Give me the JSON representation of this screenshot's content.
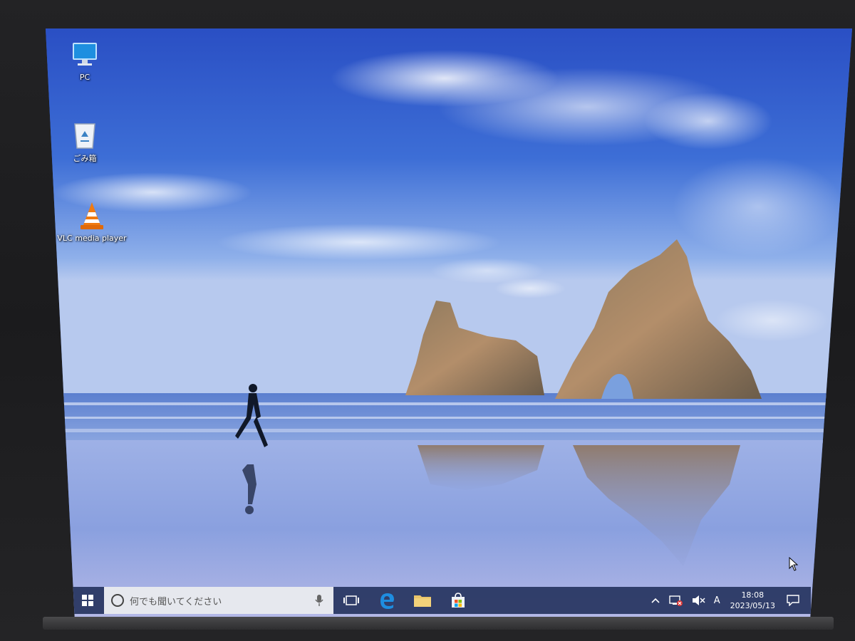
{
  "desktop": {
    "icons": [
      {
        "id": "pc",
        "label": "PC",
        "icon": "pc-monitor-icon"
      },
      {
        "id": "recycle-bin",
        "label": "ごみ箱",
        "icon": "recycle-bin-icon"
      },
      {
        "id": "vlc",
        "label": "VLC media player",
        "icon": "vlc-cone-icon"
      }
    ]
  },
  "taskbar": {
    "start_icon": "windows-logo-icon",
    "search": {
      "placeholder": "何でも聞いてください"
    },
    "pinned": [
      {
        "id": "task-view",
        "icon": "task-view-icon"
      },
      {
        "id": "edge",
        "icon": "edge-icon"
      },
      {
        "id": "file-explorer",
        "icon": "folder-icon"
      },
      {
        "id": "store",
        "icon": "store-bag-icon"
      }
    ],
    "tray": {
      "ime_mode": "A",
      "time": "18:08",
      "date": "2023/05/13"
    }
  },
  "colors": {
    "taskbar": "#263460",
    "search_box": "#e6e8ee",
    "accent_edge": "#1e8de0",
    "sky_top": "#2f55c8",
    "sky_horizon": "#9cb6e8"
  }
}
